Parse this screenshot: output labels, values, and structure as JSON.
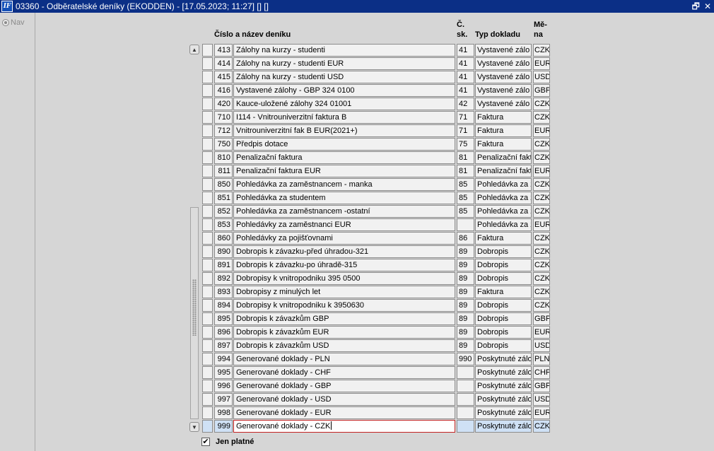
{
  "window": {
    "title": "03360 - Odběratelské deníky (EKODDEN) - [17.05.2023; 11:27]  [] []",
    "icon_label": "IF",
    "restore_glyph": "🗗",
    "close_glyph": "✕"
  },
  "sidebar": {
    "nav_label": "Nav"
  },
  "columns": {
    "name_header": "Číslo a název deníku",
    "sk_header_1": "Č.",
    "sk_header_2": "sk.",
    "type_header": "Typ dokladu",
    "cur_header_1": "Mě-",
    "cur_header_2": "na"
  },
  "rows": [
    {
      "num": "413",
      "name": "Zálohy na kurzy - studenti",
      "sk": "41",
      "type": "Vystavené zálo",
      "cur": "CZK"
    },
    {
      "num": "414",
      "name": "Zálohy na kurzy - studenti EUR",
      "sk": "41",
      "type": "Vystavené zálo",
      "cur": "EUR"
    },
    {
      "num": "415",
      "name": "Zálohy na kurzy - studenti USD",
      "sk": "41",
      "type": "Vystavené zálo",
      "cur": "USD"
    },
    {
      "num": "416",
      "name": "Vystavené zálohy - GBP 324 0100",
      "sk": "41",
      "type": "Vystavené zálo",
      "cur": "GBP"
    },
    {
      "num": "420",
      "name": "Kauce-uložené zálohy 324 01001",
      "sk": "42",
      "type": "Vystavené zálo",
      "cur": "CZK"
    },
    {
      "num": "710",
      "name": "I114 - Vnitrouniverzitní faktura  B",
      "sk": "71",
      "type": "Faktura",
      "cur": "CZK"
    },
    {
      "num": "712",
      "name": "Vnitrouniverzitní fak B EUR(2021+)",
      "sk": "71",
      "type": "Faktura",
      "cur": "EUR"
    },
    {
      "num": "750",
      "name": "Předpis dotace",
      "sk": "75",
      "type": "Faktura",
      "cur": "CZK"
    },
    {
      "num": "810",
      "name": "Penalizační faktura",
      "sk": "81",
      "type": "Penalizační fakt",
      "cur": "CZK"
    },
    {
      "num": "811",
      "name": "Penalizační faktura EUR",
      "sk": "81",
      "type": "Penalizační fakt",
      "cur": "EUR"
    },
    {
      "num": "850",
      "name": "Pohledávka za zaměstnancem - manka",
      "sk": "85",
      "type": "Pohledávka za z",
      "cur": "CZK"
    },
    {
      "num": "851",
      "name": "Pohledávka za studentem",
      "sk": "85",
      "type": "Pohledávka za z",
      "cur": "CZK"
    },
    {
      "num": "852",
      "name": "Pohledávka za zaměstnancem -ostatní",
      "sk": "85",
      "type": "Pohledávka za z",
      "cur": "CZK"
    },
    {
      "num": "853",
      "name": "Pohledávky za zaměstnanci EUR",
      "sk": "",
      "type": "Pohledávka za z",
      "cur": "EUR"
    },
    {
      "num": "860",
      "name": "Pohledávky za pojišťovnami",
      "sk": "86",
      "type": "Faktura",
      "cur": "CZK"
    },
    {
      "num": "890",
      "name": "Dobropis k závazku-před úhradou-321",
      "sk": "89",
      "type": "Dobropis",
      "cur": "CZK"
    },
    {
      "num": "891",
      "name": "Dobropis k závazku-po úhradě-315",
      "sk": "89",
      "type": "Dobropis",
      "cur": "CZK"
    },
    {
      "num": "892",
      "name": "Dobropisy k vnitropodniku 395 0500",
      "sk": "89",
      "type": "Dobropis",
      "cur": "CZK"
    },
    {
      "num": "893",
      "name": "Dobropisy z minulých let",
      "sk": "89",
      "type": "Faktura",
      "cur": "CZK"
    },
    {
      "num": "894",
      "name": "Dobropisy k vnitropodniku k 3950630",
      "sk": "89",
      "type": "Dobropis",
      "cur": "CZK"
    },
    {
      "num": "895",
      "name": "Dobropis k závazkům GBP",
      "sk": "89",
      "type": "Dobropis",
      "cur": "GBP"
    },
    {
      "num": "896",
      "name": "Dobropis k závazkům EUR",
      "sk": "89",
      "type": "Dobropis",
      "cur": "EUR"
    },
    {
      "num": "897",
      "name": "Dobropis k závazkům USD",
      "sk": "89",
      "type": "Dobropis",
      "cur": "USD"
    },
    {
      "num": "994",
      "name": "Generované doklady - PLN",
      "sk": "990",
      "type": "Poskytnuté zálo",
      "cur": "PLN"
    },
    {
      "num": "995",
      "name": "Generované doklady - CHF",
      "sk": "",
      "type": "Poskytnuté zálo",
      "cur": "CHF"
    },
    {
      "num": "996",
      "name": "Generované doklady - GBP",
      "sk": "",
      "type": "Poskytnuté zálo",
      "cur": "GBP"
    },
    {
      "num": "997",
      "name": "Generované doklady - USD",
      "sk": "",
      "type": "Poskytnuté zálo",
      "cur": "USD"
    },
    {
      "num": "998",
      "name": "Generované doklady - EUR",
      "sk": "",
      "type": "Poskytnuté zálo",
      "cur": "EUR"
    },
    {
      "num": "999",
      "name": "Generované doklady - CZK",
      "sk": "",
      "type": "Poskytnuté zálo",
      "cur": "CZK",
      "selected": true
    }
  ],
  "filter": {
    "label": "Jen platné",
    "checked": true,
    "check_glyph": "✔"
  },
  "scroll": {
    "up_glyph": "▲",
    "down_glyph": "▼"
  },
  "colors": {
    "titlebar": "#0b2f86",
    "background": "#d6d6d6",
    "selected_row": "#cfe1f5",
    "focus_border": "#c32222"
  }
}
